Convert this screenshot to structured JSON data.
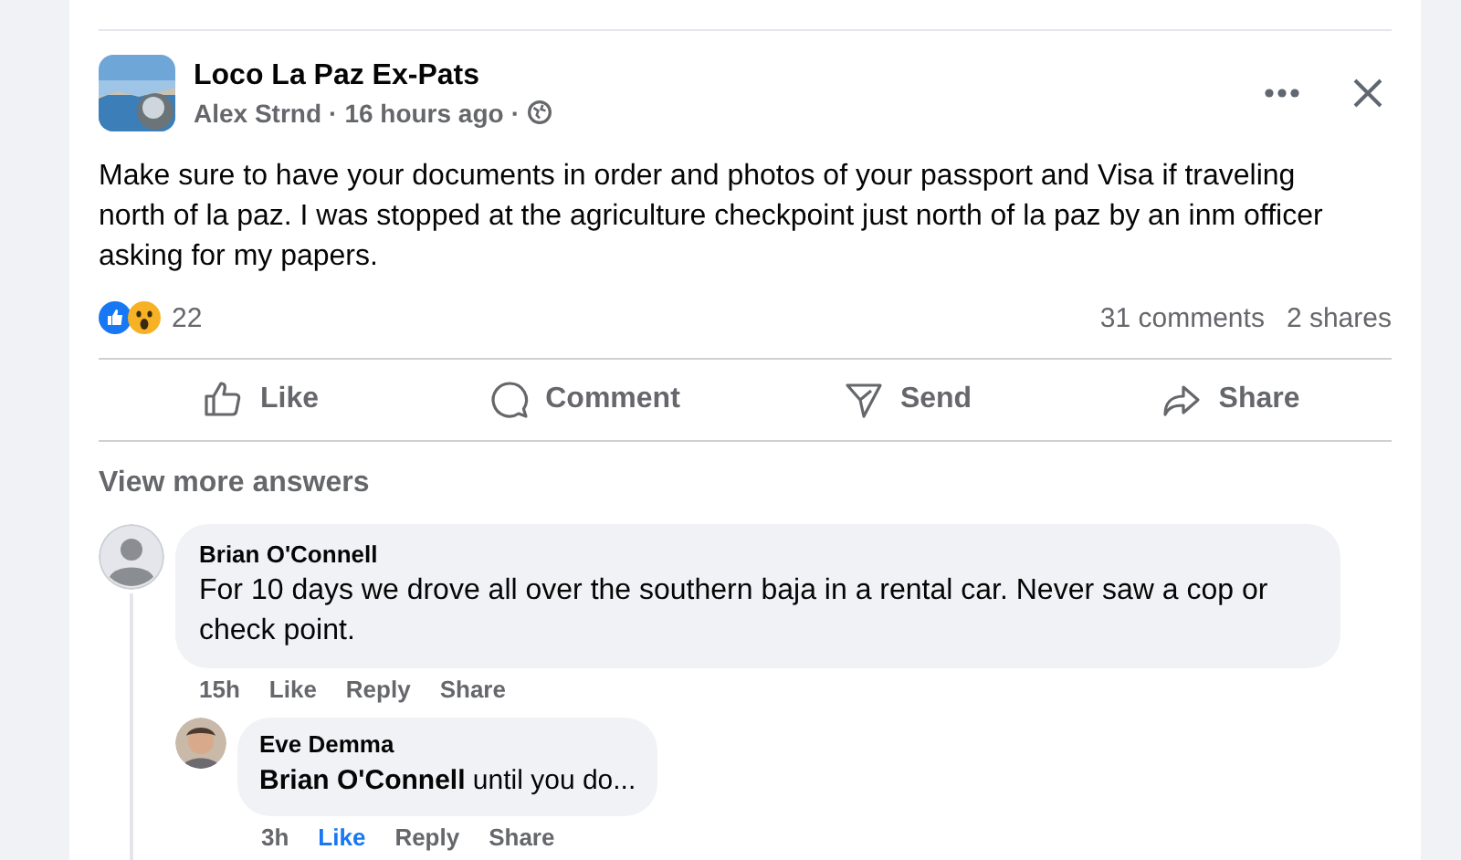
{
  "post": {
    "group": "Loco La Paz Ex-Pats",
    "author": "Alex Strnd",
    "time": "16 hours ago",
    "audience_separator": "·",
    "separator": "·",
    "text": "Make sure to have your documents in order and photos of your passport and Visa if traveling north of la paz. I was stopped at the agriculture checkpoint just north of la paz by an inm officer asking for my papers.",
    "reaction_count": "22",
    "comments": "31 comments",
    "shares": "2 shares",
    "actions": [
      {
        "kind": "like",
        "label": "Like"
      },
      {
        "kind": "comment",
        "label": "Comment"
      },
      {
        "kind": "send",
        "label": "Send"
      },
      {
        "kind": "share",
        "label": "Share"
      }
    ]
  },
  "view_more": "View more answers",
  "comments": [
    {
      "author": "Brian O'Connell",
      "text": "For 10 days we drove all over the southern baja in a rental car. Never saw a cop or check point.",
      "time": "15h",
      "liked": false,
      "like": "Like",
      "reply": "Reply",
      "share": "Share",
      "kind": "silhouette",
      "replies": [
        {
          "author": "Eve Demma",
          "text": "**Brian O'Connell** until you do...",
          "time": "3h",
          "liked": true,
          "like": "Like",
          "reply": "Reply",
          "share": "Share"
        }
      ]
    }
  ]
}
